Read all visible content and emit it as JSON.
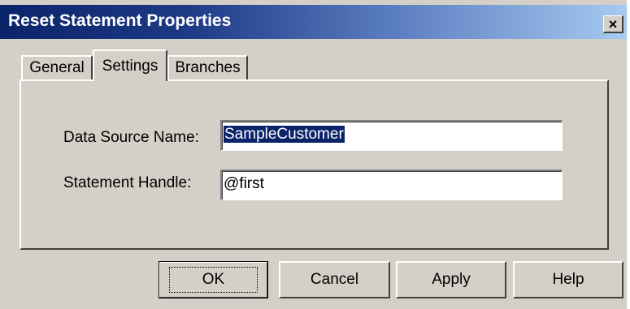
{
  "window": {
    "title": "Reset Statement Properties",
    "close_label": "×"
  },
  "tabs": [
    {
      "label": "General",
      "active": false
    },
    {
      "label": "Settings",
      "active": true
    },
    {
      "label": "Branches",
      "active": false
    }
  ],
  "form": {
    "data_source_label": "Data Source Name:",
    "data_source_value": "SampleCustomer",
    "statement_handle_label": "Statement Handle:",
    "statement_handle_value": "@first"
  },
  "buttons": {
    "ok": "OK",
    "cancel": "Cancel",
    "apply": "Apply",
    "help": "Help"
  }
}
